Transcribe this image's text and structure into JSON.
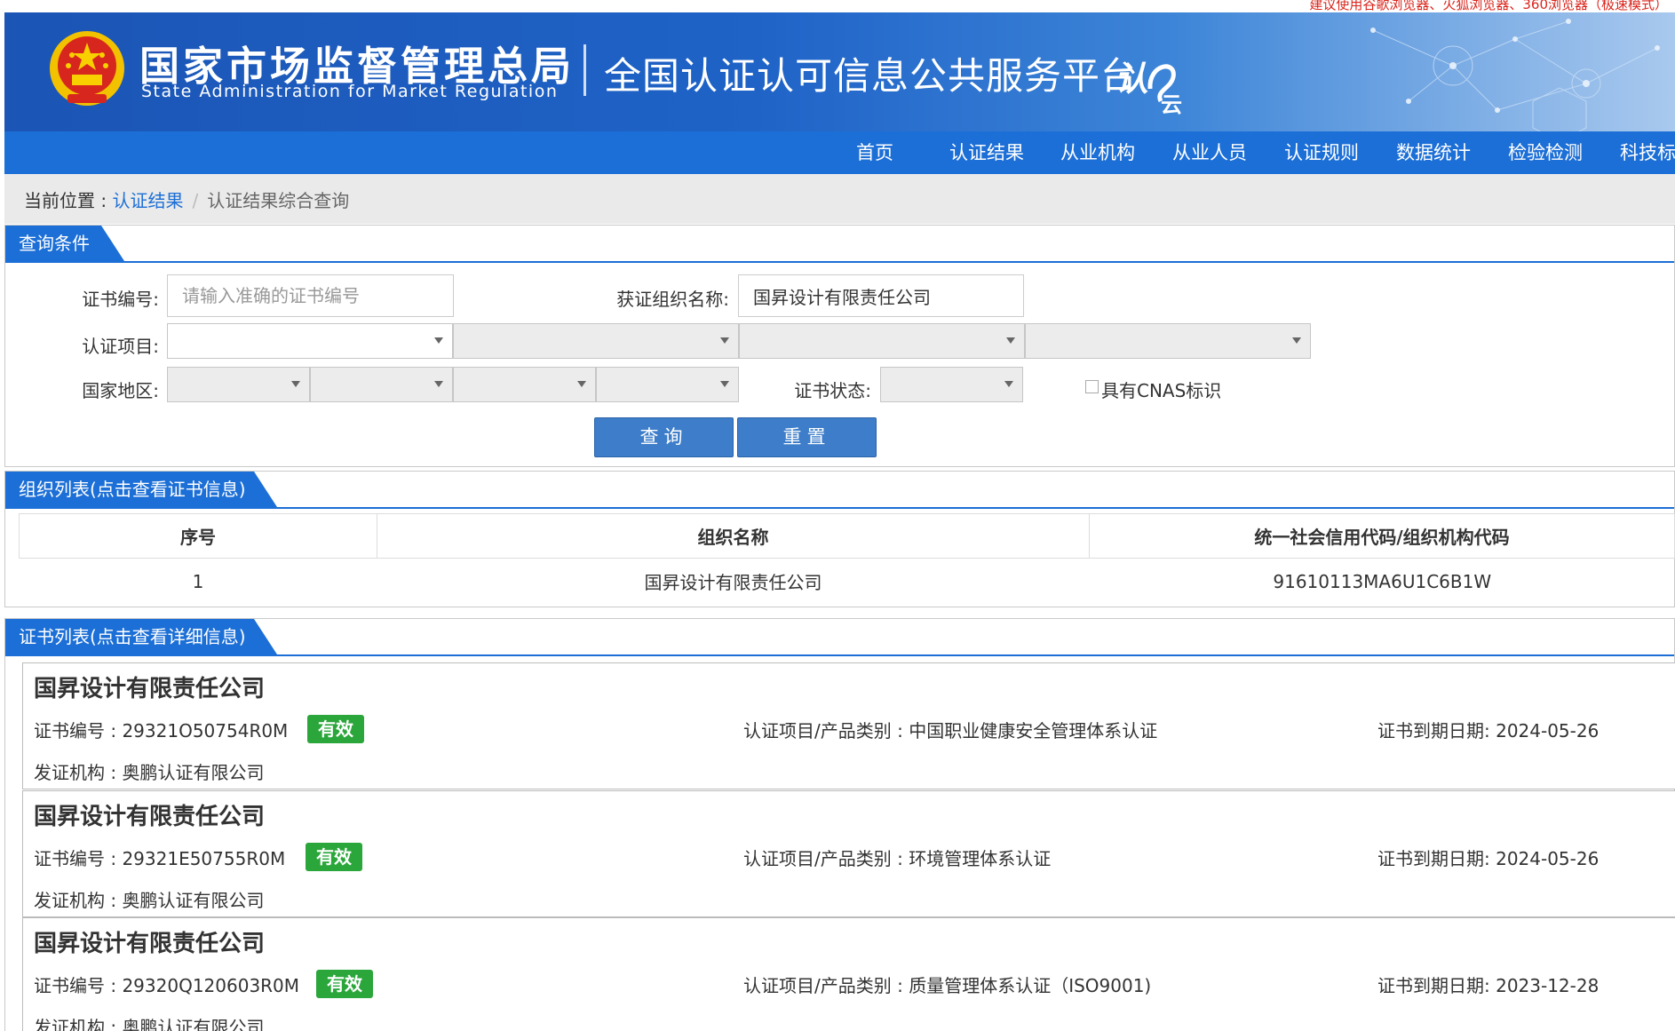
{
  "top_notice": "建议使用谷歌浏览器、火狐浏览器、360浏览器（极速模式）",
  "header": {
    "sam_cn": "国家市场监督管理总局",
    "sam_en": "State Administration  for  Market Regulation",
    "platform": "全国认证认可信息公共服务平台",
    "platform_logo": "认e云"
  },
  "nav": [
    "首页",
    "认证结果",
    "从业机构",
    "从业人员",
    "认证规则",
    "数据统计",
    "检验检测",
    "科技标"
  ],
  "breadcrumb": {
    "prefix": "当前位置 : ",
    "link": "认证结果",
    "sep": "/",
    "current": "认证结果综合查询"
  },
  "query": {
    "title": "查询条件",
    "cert_no_label": "证书编号:",
    "cert_no_placeholder": "请输入准确的证书编号",
    "cert_no_value": "",
    "org_name_label": "获证组织名称:",
    "org_name_value": "国昇设计有限责任公司",
    "project_label": "认证项目:",
    "region_label": "国家地区:",
    "status_label": "证书状态:",
    "cnas_label": "具有CNAS标识",
    "search_btn": "查询",
    "reset_btn": "重置"
  },
  "org_list": {
    "title": "组织列表(点击查看证书信息)",
    "headers": [
      "序号",
      "组织名称",
      "统一社会信用代码/组织机构代码"
    ],
    "rows": [
      [
        "1",
        "国昇设计有限责任公司",
        "91610113MA6U1C6B1W"
      ]
    ]
  },
  "cert_list": {
    "title": "证书列表(点击查看详细信息)",
    "items": [
      {
        "name": "国昇设计有限责任公司",
        "no": "证书编号 : 29321O50754R0M",
        "status": "有效",
        "project": "认证项目/产品类别 : 中国职业健康安全管理体系认证",
        "expiry": "证书到期日期: 2024-05-26",
        "issuer": "发证机构 : 奥鹏认证有限公司"
      },
      {
        "name": "国昇设计有限责任公司",
        "no": "证书编号 : 29321E50755R0M",
        "status": "有效",
        "project": "认证项目/产品类别 : 环境管理体系认证",
        "expiry": "证书到期日期: 2024-05-26",
        "issuer": "发证机构 : 奥鹏认证有限公司"
      },
      {
        "name": "国昇设计有限责任公司",
        "no": "证书编号 : 29320Q120603R0M",
        "status": "有效",
        "project": "认证项目/产品类别 : 质量管理体系认证（ISO9001)",
        "expiry": "证书到期日期: 2023-12-28",
        "issuer": "发证机构 : 奥鹏认证有限公司"
      }
    ]
  },
  "colors": {
    "brand_blue": "#1c6fd6",
    "valid_green": "#2aa63a",
    "notice_red": "#d9251c"
  }
}
